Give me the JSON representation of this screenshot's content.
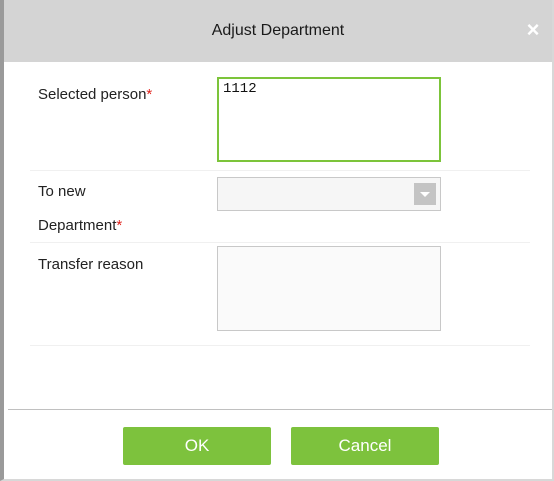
{
  "dialog": {
    "title": "Adjust Department",
    "close_symbol": "×"
  },
  "form": {
    "selected_person_label": "Selected person",
    "selected_person_value": "1112",
    "department_label_line1": "To new",
    "department_label_line2": "Department",
    "department_value": "",
    "transfer_reason_label": "Transfer reason",
    "transfer_reason_value": "",
    "required_mark": "*"
  },
  "buttons": {
    "ok_label": "OK",
    "cancel_label": "Cancel"
  },
  "colors": {
    "accent_green": "#7dc23d",
    "focus_border": "#7cc43a",
    "required_red": "#e0201a",
    "titlebar_bg": "#d4d4d4"
  },
  "icons": {
    "close": "close-icon",
    "dropdown": "chevron-down-icon"
  }
}
